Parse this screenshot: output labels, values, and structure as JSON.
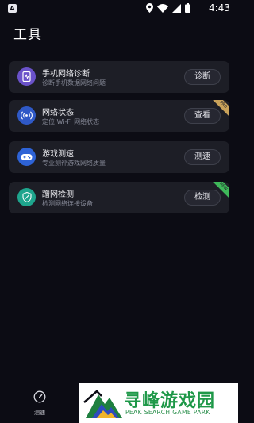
{
  "status_bar": {
    "app_icon": "A",
    "icons": [
      "location-icon",
      "wifi-icon",
      "signal-icon",
      "battery-icon"
    ],
    "time": "4:43"
  },
  "page": {
    "title": "工具"
  },
  "tools": [
    {
      "title": "手机网络诊断",
      "subtitle": "诊断手机数据网络问题",
      "button": "诊断",
      "icon": "phone-diagnose-icon",
      "icon_color": "#6a52c9",
      "badge": ""
    },
    {
      "title": "网络状态",
      "subtitle": "定位 Wi-Fi 网络状态",
      "button": "查看",
      "icon": "wifi-signal-icon",
      "icon_color": "#2f59c7",
      "badge": "PRO",
      "badge_color": "#c9a25a"
    },
    {
      "title": "游戏测速",
      "subtitle": "专业测评游戏网络质量",
      "button": "测速",
      "icon": "gamepad-icon",
      "icon_color": "#2e63d6",
      "badge": ""
    },
    {
      "title": "蹭网检测",
      "subtitle": "检测网络连接设备",
      "button": "检测",
      "icon": "shield-icon",
      "icon_color": "#1ea58d",
      "badge": "NEW",
      "badge_color": "#3fb85a"
    }
  ],
  "bottom_nav": {
    "items": [
      {
        "label": "测速",
        "icon": "speedometer-icon"
      }
    ]
  },
  "watermark": {
    "title": "寻峰游戏园",
    "subtitle": "PEAK SEARCH GAME PARK"
  }
}
